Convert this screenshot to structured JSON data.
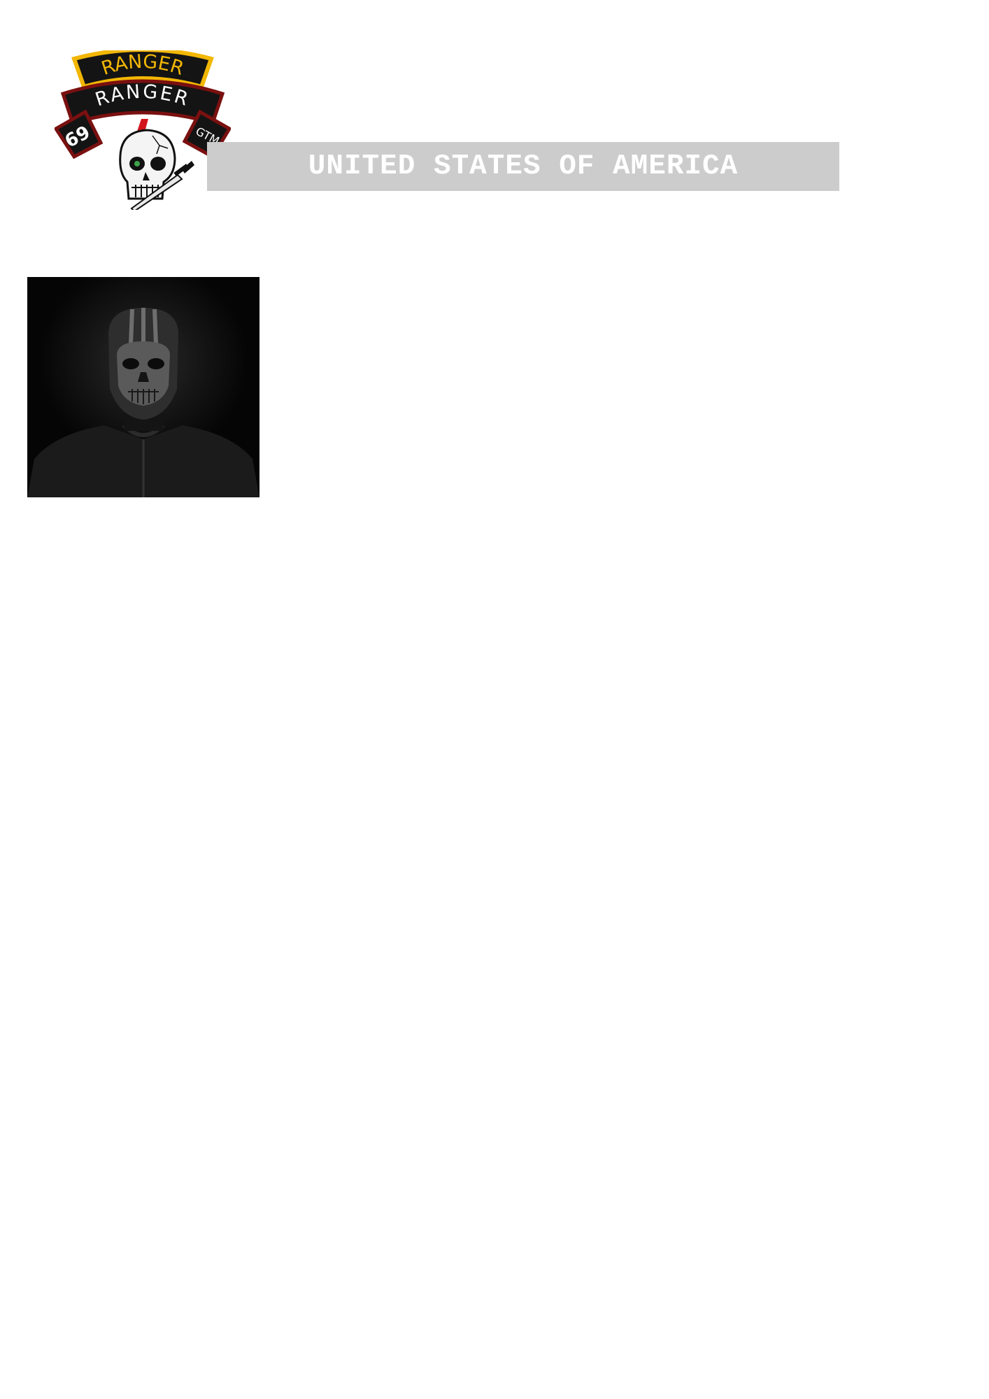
{
  "header": {
    "insignia": {
      "top_tab_text": "RANGER",
      "middle_tab_text": "RANGER",
      "left_tab_text": "69",
      "right_tab_text": "GTM",
      "tab_gold": "#f2b705",
      "tab_black": "#141414",
      "tab_border_red": "#7a1010",
      "lightning_red": "#d4141b",
      "icon": "skull-dagger-icon"
    },
    "banner": {
      "text": "UNITED STATES OF AMERICA",
      "background": "#cccccc",
      "text_color": "#ffffff"
    }
  },
  "photo": {
    "icon": "masked-skull-figure-icon"
  }
}
